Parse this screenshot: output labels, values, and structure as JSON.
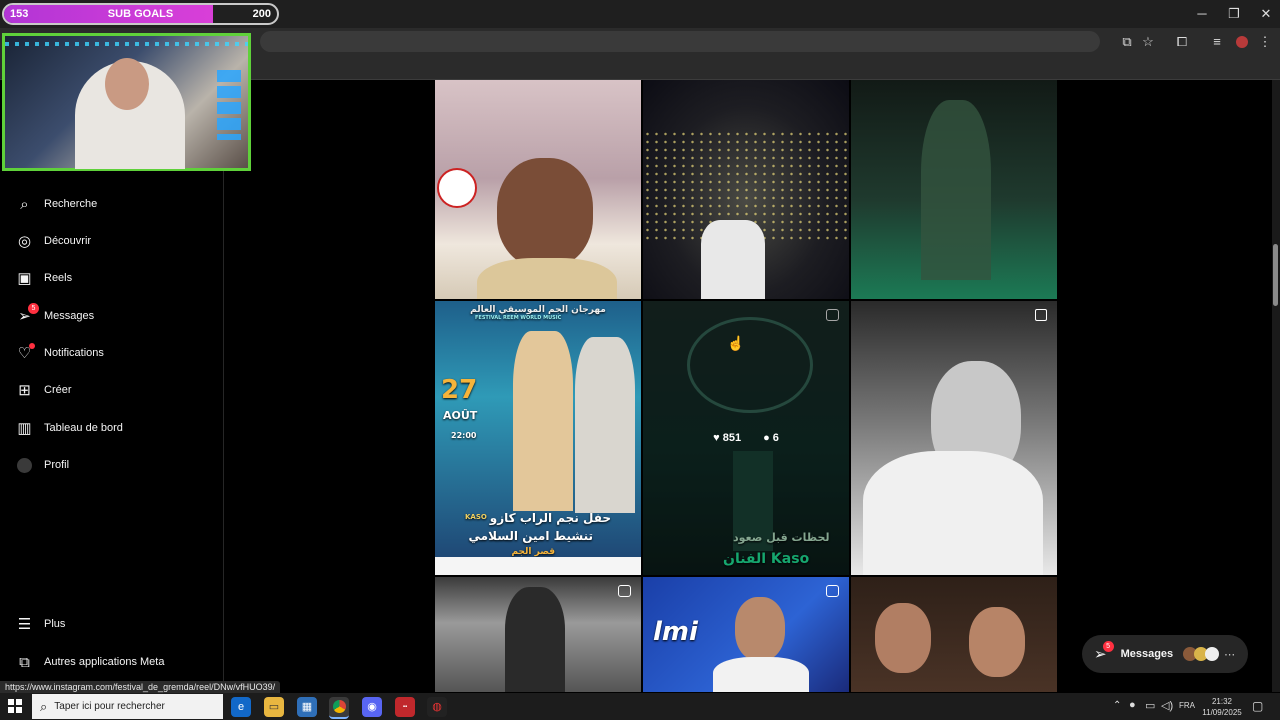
{
  "overlay": {
    "goal_left": "153",
    "goal_title": "SUB GOALS",
    "goal_right": "200",
    "goal_progress": 0.765
  },
  "sidebar": {
    "items": [
      {
        "label": "Recherche",
        "icon": "search-icon"
      },
      {
        "label": "Découvrir",
        "icon": "compass-icon"
      },
      {
        "label": "Reels",
        "icon": "reels-icon"
      },
      {
        "label": "Messages",
        "icon": "messenger-icon",
        "badge": "5"
      },
      {
        "label": "Notifications",
        "icon": "heart-icon"
      },
      {
        "label": "Créer",
        "icon": "plus-square-icon"
      },
      {
        "label": "Tableau de bord",
        "icon": "bar-chart-icon"
      },
      {
        "label": "Profil",
        "icon": "avatar-icon"
      }
    ],
    "more": "Plus",
    "meta": "Autres applications Meta"
  },
  "grid": {
    "hover_likes": "851",
    "hover_comments": "6",
    "poster_day": "27",
    "poster_month": "AOÛT",
    "poster_time": "22:00",
    "poster_fest": "FESTIVAL REEM WORLD MUSIC",
    "poster_line1": "حفل نجم الراب كازو",
    "poster_line2": "تنشيط امين السلامي",
    "poster_line3": "قصر الجم",
    "poster_kaso": "KASO",
    "reel_caption1": "لحظات قبل صعود",
    "reel_caption2": "الفنان Kaso",
    "tile_text_helmi": "lmi",
    "poster_top": "مهرجان الجم الموسيقي العالم"
  },
  "messages_pill": {
    "label": "Messages",
    "badge": "5"
  },
  "status_url": "https://www.instagram.com/festival_de_gremda/reel/DNw/vfHUO39/",
  "taskbar": {
    "search_placeholder": "Taper ici pour rechercher",
    "lang": "FRA",
    "time": "21:32",
    "date": "11/09/2025"
  },
  "colors": {
    "accent_badge": "#ff3040",
    "goal": "#d93fd8",
    "cam_border": "#5fd13a"
  }
}
